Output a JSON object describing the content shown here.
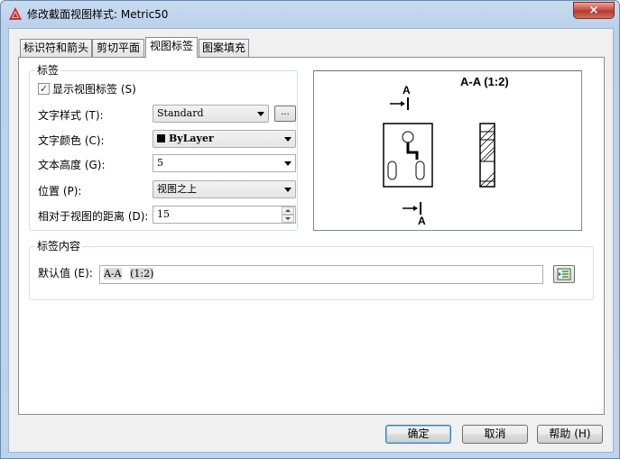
{
  "window": {
    "title": "修改截面视图样式: Metric50",
    "close_symbol": "×"
  },
  "tabs": [
    {
      "label": "标识符和箭头"
    },
    {
      "label": "剪切平面"
    },
    {
      "label": "视图标签"
    },
    {
      "label": "图案填充"
    }
  ],
  "label_group": {
    "title": "标签",
    "show_label_checkbox": {
      "label": "显示视图标签 (S)",
      "checked": true,
      "mark": "✓"
    },
    "text_style": {
      "label": "文字样式 (T):",
      "value": "Standard",
      "browse_label": "..."
    },
    "text_color": {
      "label": "文字颜色 (C):",
      "value": "ByLayer",
      "swatch": "#000000"
    },
    "text_height": {
      "label": "文本高度 (G):",
      "value": "5"
    },
    "position": {
      "label": "位置 (P):",
      "value": "视图之上"
    },
    "distance": {
      "label": "相对于视图的距离 (D):",
      "value": "15"
    }
  },
  "preview": {
    "view_title": "A-A (1:2)",
    "marker_top": "A",
    "marker_bottom": "A"
  },
  "content_group": {
    "title": "标签内容",
    "default_label": "默认值 (E):",
    "default_part1": "A-A",
    "default_part2": "(1:2)"
  },
  "buttons": {
    "ok": "确定",
    "cancel": "取消",
    "help": "帮助 (H)"
  }
}
